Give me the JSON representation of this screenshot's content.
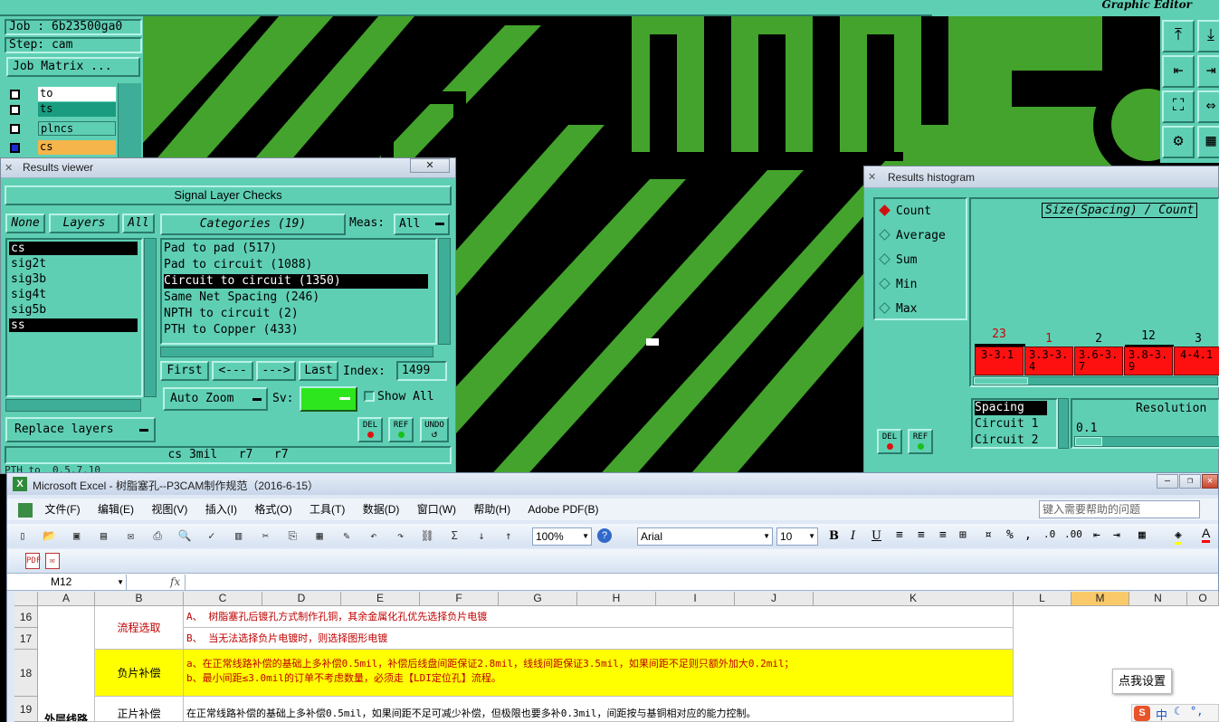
{
  "job": {
    "job_label": "Job : 6b23500ga0",
    "step_label": "Step: cam",
    "matrix_button": "Job Matrix ..."
  },
  "layers_panel": {
    "items": [
      {
        "name": "to"
      },
      {
        "name": "ts"
      },
      {
        "name": "plncs"
      },
      {
        "name": "cs"
      }
    ]
  },
  "graphic_editor": {
    "title": "Graphic Editor"
  },
  "results_viewer": {
    "title": "Results viewer",
    "header": "Signal Layer Checks",
    "none_btn": "None",
    "layers_btn": "Layers",
    "all_btn": "All",
    "layer_list": [
      "cs",
      "sig2t",
      "sig3b",
      "sig4t",
      "sig5b",
      "ss"
    ],
    "categories_btn": "Categories (19)",
    "meas_label": "Meas:",
    "meas_value": "All",
    "categories": [
      "Pad to pad (517)",
      "Pad to circuit (1088)",
      "Circuit to circuit (1350)",
      "Same Net Spacing (246)",
      "NPTH to circuit (2)",
      "PTH to Copper (433)"
    ],
    "first_btn": "First",
    "prev_btn": "<---",
    "next_btn": "--->",
    "last_btn": "Last",
    "index_label": "Index:",
    "index_value": "1499",
    "autozoom_btn": "Auto Zoom",
    "sv_label": "Sv:",
    "show_all_label": "Show All",
    "replace_layers_btn": "Replace layers",
    "del_label": "DEL",
    "ref_label": "REF",
    "undo_label": "UNDO",
    "status": "cs 3mil   r7   r7",
    "status2": "PTH to  0.5.7.10"
  },
  "histogram": {
    "title": "Results histogram",
    "options": [
      "Count",
      "Average",
      "Sum",
      "Min",
      "Max"
    ],
    "selected_option": "Count",
    "chart_title": "Size(Spacing) / Count",
    "bars": [
      {
        "count": "23",
        "range": "3-3.1"
      },
      {
        "count": "1",
        "range": "3.3-3.4"
      },
      {
        "count": "2",
        "range": "3.6-3.7"
      },
      {
        "count": "12",
        "range": "3.8-3.9"
      },
      {
        "count": "3",
        "range": "4-4.1"
      }
    ],
    "list": [
      "Spacing",
      "Circuit 1",
      "Circuit 2"
    ],
    "resolution_label": "Resolution",
    "resolution_value": "0.1",
    "del_label": "DEL",
    "ref_label": "REF"
  },
  "excel": {
    "title": "Microsoft Excel - 树脂塞孔--P3CAM制作规范（2016-6-15）",
    "menu": [
      "文件(F)",
      "编辑(E)",
      "视图(V)",
      "插入(I)",
      "格式(O)",
      "工具(T)",
      "数据(D)",
      "窗口(W)",
      "帮助(H)",
      "Adobe PDF(B)"
    ],
    "help_placeholder": "键入需要帮助的问题",
    "zoom": "100%",
    "font_name": "Arial",
    "font_size": "10",
    "name_box": "M12",
    "fx": "fx",
    "columns": [
      "A",
      "B",
      "C",
      "D",
      "E",
      "F",
      "G",
      "H",
      "I",
      "J",
      "K",
      "L",
      "M",
      "N",
      "O"
    ],
    "rows": [
      {
        "num": "16",
        "b": "流程选取",
        "c": "A、  树脂塞孔后镀孔方式制作孔铜，其余金属化孔优先选择负片电镀"
      },
      {
        "num": "17",
        "b": "",
        "c": "B、  当无法选择负片电镀时，则选择图形电镀"
      },
      {
        "num": "18",
        "b": "负片补偿",
        "c": "a、在正常线路补偿的基础上多补偿0.5mil，补偿后线盘间距保证2.8mil，线线间距保证3.5mil，如果间距不足则只额外加大0.2mil；",
        "c2": "b、最小间距≤3.0mil的订单不考虑数量，必须走【LDI定位孔】流程。"
      },
      {
        "num": "19",
        "a": "外层线路",
        "b": "正片补偿",
        "c": "在正常线路补偿的基础上多补偿0.5mil，如果间距不足可减少补偿，但极限也要多补0.3mil，间距按与基铜相对应的能力控制。"
      }
    ],
    "popup_button": "点我设置",
    "ime_label": "中"
  }
}
